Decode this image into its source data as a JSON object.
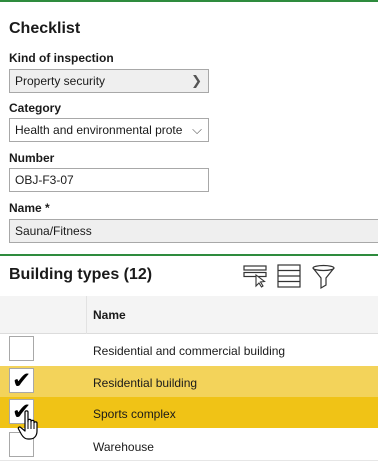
{
  "checklist": {
    "title": "Checklist",
    "kind_of_inspection": {
      "label": "Kind of inspection",
      "value": "Property security"
    },
    "category": {
      "label": "Category",
      "value": "Health and environmental prote"
    },
    "number": {
      "label": "Number",
      "value": "OBJ-F3-07"
    },
    "name": {
      "label": "Name *",
      "value": "Sauna/Fitness"
    }
  },
  "building_types": {
    "title": "Building types (12)",
    "toolbar_icons": [
      "select-rows-icon",
      "list-view-icon",
      "filter-icon"
    ],
    "columns": [
      "",
      "Name"
    ],
    "rows": [
      {
        "name": "Residential and commercial building",
        "checked": false,
        "state": "normal"
      },
      {
        "name": "Residential building",
        "checked": true,
        "state": "selected"
      },
      {
        "name": "Sports complex",
        "checked": true,
        "state": "hover"
      },
      {
        "name": "Warehouse",
        "checked": false,
        "state": "normal"
      }
    ]
  },
  "colors": {
    "accent_line": "#2e8b3d",
    "row_selected": "#f3d35a",
    "row_hover": "#f0c316",
    "header_bg": "#f4f4f4"
  }
}
